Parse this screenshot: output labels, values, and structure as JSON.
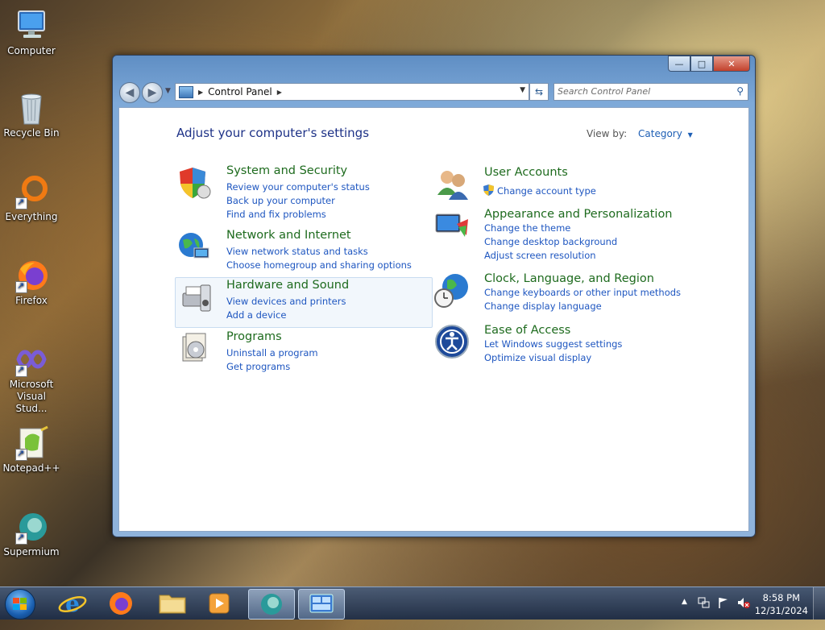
{
  "desktop": {
    "icons": [
      {
        "label": "Computer"
      },
      {
        "label": "Recycle Bin"
      },
      {
        "label": "Everything"
      },
      {
        "label": "Firefox"
      },
      {
        "label": "Microsoft Visual Stud..."
      },
      {
        "label": "Notepad++"
      },
      {
        "label": "Supermium"
      }
    ]
  },
  "window": {
    "caption_buttons": {
      "minimize": "—",
      "maximize": "□",
      "close": "✕"
    },
    "nav": {
      "back_icon": "◀",
      "forward_icon": "▶"
    },
    "address": {
      "crumb": "Control Panel"
    },
    "search": {
      "placeholder": "Search Control Panel"
    },
    "heading": "Adjust your computer's settings",
    "view_by": {
      "label": "View by:",
      "value": "Category"
    },
    "categories_left": [
      {
        "title": "System and Security",
        "links": [
          "Review your computer's status",
          "Back up your computer",
          "Find and fix problems"
        ]
      },
      {
        "title": "Network and Internet",
        "links": [
          "View network status and tasks",
          "Choose homegroup and sharing options"
        ]
      },
      {
        "title": "Hardware and Sound",
        "links": [
          "View devices and printers",
          "Add a device"
        ]
      },
      {
        "title": "Programs",
        "links": [
          "Uninstall a program",
          "Get programs"
        ]
      }
    ],
    "categories_right": [
      {
        "title": "User Accounts",
        "links": [
          "Change account type"
        ]
      },
      {
        "title": "Appearance and Personalization",
        "links": [
          "Change the theme",
          "Change desktop background",
          "Adjust screen resolution"
        ]
      },
      {
        "title": "Clock, Language, and Region",
        "links": [
          "Change keyboards or other input methods",
          "Change display language"
        ]
      },
      {
        "title": "Ease of Access",
        "links": [
          "Let Windows suggest settings",
          "Optimize visual display"
        ]
      }
    ]
  },
  "taskbar": {
    "pinned": [
      "internet-explorer",
      "firefox",
      "file-explorer",
      "media-player",
      "supermium",
      "control-panel"
    ],
    "tray": {
      "overflow": "▲"
    },
    "clock": {
      "time": "8:58 PM",
      "date": "12/31/2024"
    }
  },
  "colors": {
    "category_title": "#1e6b1e",
    "link": "#1e56c0",
    "heading": "#1e3287"
  }
}
